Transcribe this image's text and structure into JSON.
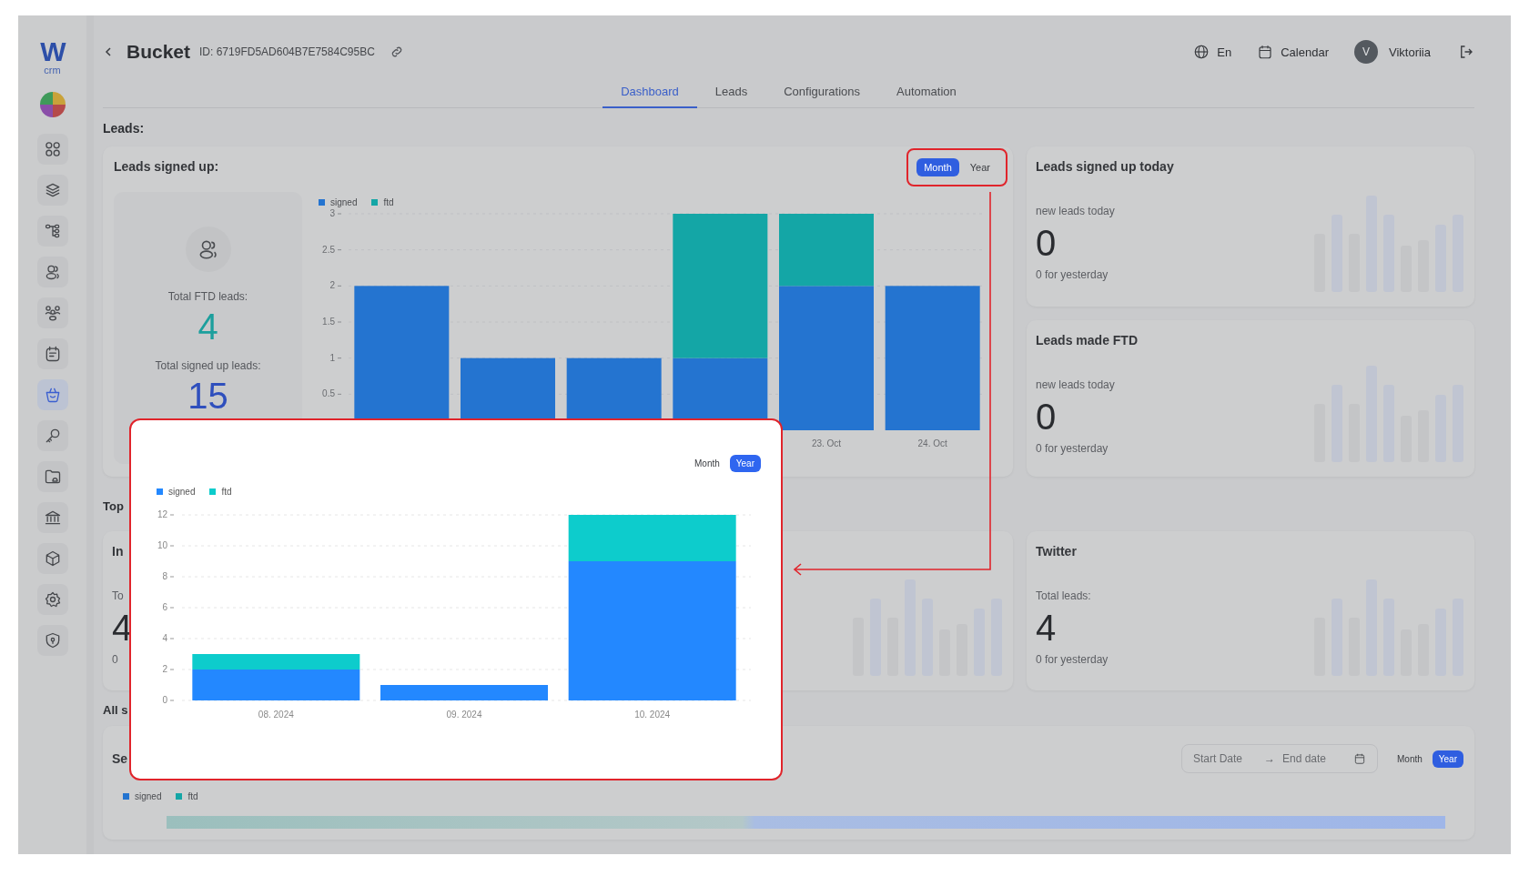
{
  "sidebar": {
    "logo": "W",
    "logo_caption": "crm",
    "items": [
      {
        "selected": false
      },
      {
        "selected": false
      },
      {
        "selected": false
      },
      {
        "selected": false
      },
      {
        "selected": false
      },
      {
        "selected": false
      },
      {
        "selected": true
      },
      {
        "selected": false
      },
      {
        "selected": false
      },
      {
        "selected": false
      },
      {
        "selected": false
      },
      {
        "selected": false
      },
      {
        "selected": false
      }
    ]
  },
  "header": {
    "title": "Bucket",
    "id": "ID: 6719FD5AD604B7E7584C95BC",
    "language": "En",
    "calendar": "Calendar",
    "user_initial": "V",
    "user_name": "Viktoriia"
  },
  "tabs": [
    {
      "label": "Dashboard",
      "selected": true
    },
    {
      "label": "Leads",
      "selected": false
    },
    {
      "label": "Configurations",
      "selected": false
    },
    {
      "label": "Automation",
      "selected": false
    }
  ],
  "section_title": "Leads:",
  "signup_card": {
    "title": "Leads signed up:",
    "period_toggle": [
      {
        "label": "Month",
        "selected": true
      },
      {
        "label": "Year",
        "selected": false
      }
    ],
    "ftd_label": "Total FTD leads:",
    "ftd_value": "4",
    "signed_label": "Total signed up leads:",
    "signed_value": "15",
    "chart_data": {
      "type": "bar",
      "stacked": true,
      "grid": true,
      "legend": true,
      "categories": [
        null,
        null,
        null,
        null,
        "23. Oct",
        "24. Oct"
      ],
      "ylim": [
        0,
        3
      ],
      "yticks": [
        0.5,
        1,
        1.5,
        2,
        2.5,
        3
      ],
      "series": [
        {
          "name": "signed",
          "color": "#2474d0",
          "values": [
            2,
            1,
            1,
            1,
            2,
            2
          ]
        },
        {
          "name": "ftd",
          "color": "#14a6a6",
          "values": [
            0,
            0,
            0,
            2,
            1,
            0
          ]
        }
      ]
    }
  },
  "stat_cards": [
    {
      "title": "Leads signed up today",
      "label": "new leads today",
      "value": "0",
      "footnote": "0 for yesterday"
    },
    {
      "title": "Leads made FTD",
      "label": "new leads today",
      "value": "0",
      "footnote": "0 for yesterday"
    }
  ],
  "top_section": {
    "title": "Top",
    "card": {
      "title": "In",
      "label": "To",
      "value": "4",
      "footnote": "0"
    }
  },
  "twitter_card": {
    "title": "Twitter",
    "label": "Total leads:",
    "value": "4",
    "footnote": "0 for yesterday"
  },
  "all_section": {
    "title": "All s",
    "card": {
      "title": "Se",
      "start_placeholder": "Start Date",
      "separator": "→",
      "end_placeholder": "End date",
      "period_toggle": [
        {
          "label": "Month",
          "selected": false
        },
        {
          "label": "Year",
          "selected": true
        }
      ],
      "legend": [
        {
          "name": "signed",
          "color": "#2474d0"
        },
        {
          "name": "ftd",
          "color": "#14a6a6"
        }
      ]
    }
  },
  "callout": {
    "period_toggle": [
      {
        "label": "Month",
        "selected": false
      },
      {
        "label": "Year",
        "selected": true
      }
    ],
    "chart_data": {
      "type": "bar",
      "stacked": true,
      "grid": true,
      "legend": true,
      "categories": [
        "08. 2024",
        "09. 2024",
        "10. 2024"
      ],
      "ylim": [
        0,
        12
      ],
      "yticks": [
        0,
        2,
        4,
        6,
        8,
        10,
        12
      ],
      "series": [
        {
          "name": "signed",
          "color": "#2388ff",
          "values": [
            2,
            1,
            9
          ]
        },
        {
          "name": "ftd",
          "color": "#0dcccc",
          "values": [
            1,
            0,
            3
          ]
        }
      ]
    }
  }
}
